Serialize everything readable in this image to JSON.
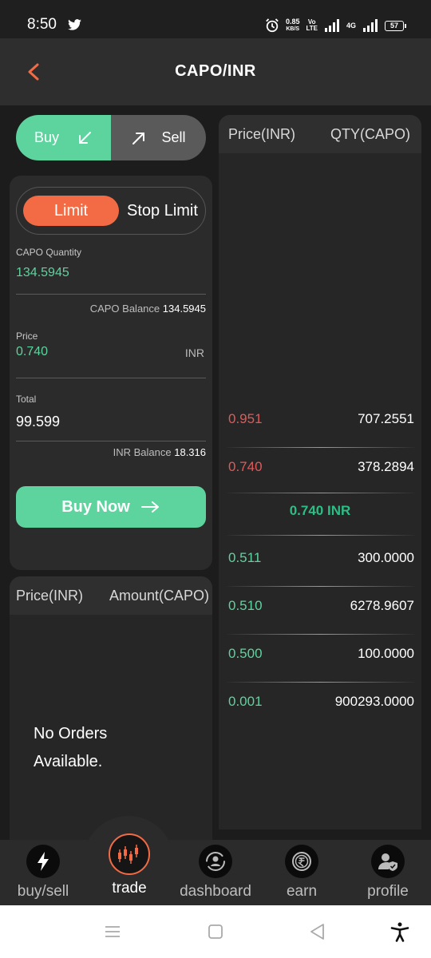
{
  "status_bar": {
    "time": "8:50",
    "net_speed_value": "0.85",
    "net_speed_unit": "KB/S",
    "volte_top": "Vo",
    "volte_bottom": "LTE",
    "network": "4G",
    "battery": "57"
  },
  "header": {
    "title": "CAPO/INR"
  },
  "side_toggle": {
    "buy_label": "Buy",
    "sell_label": "Sell"
  },
  "order_type": {
    "limit_label": "Limit",
    "stop_limit_label": "Stop Limit"
  },
  "form": {
    "quantity_label": "CAPO Quantity",
    "quantity_value": "134.5945",
    "capo_balance_label": "CAPO Balance",
    "capo_balance_value": "134.5945",
    "price_label": "Price",
    "price_value": "0.740",
    "price_unit": "INR",
    "total_label": "Total",
    "total_value": "99.599",
    "inr_balance_label": "INR Balance",
    "inr_balance_value": "18.316",
    "submit_label": "Buy Now"
  },
  "orders": {
    "col_price": "Price(INR)",
    "col_amount": "Amount(CAPO)",
    "empty_line1": "No Orders",
    "empty_line2": "Available."
  },
  "order_book": {
    "col_price": "Price(INR)",
    "col_qty": "QTY(CAPO)",
    "asks": [
      {
        "price": "0.951",
        "qty": "707.2551"
      },
      {
        "price": "0.740",
        "qty": "378.2894"
      }
    ],
    "mid_price": "0.740 INR",
    "bids": [
      {
        "price": "0.511",
        "qty": "300.0000"
      },
      {
        "price": "0.510",
        "qty": "6278.9607"
      },
      {
        "price": "0.500",
        "qty": "100.0000"
      },
      {
        "price": "0.001",
        "qty": "900293.0000"
      }
    ]
  },
  "bottom_nav": {
    "items": [
      {
        "label": "buy/sell",
        "icon": "lightning-icon"
      },
      {
        "label": "trade",
        "icon": "candlestick-icon",
        "active": true
      },
      {
        "label": "dashboard",
        "icon": "refresh-user-icon"
      },
      {
        "label": "earn",
        "icon": "rupee-icon"
      },
      {
        "label": "profile",
        "icon": "user-shield-icon"
      }
    ]
  },
  "colors": {
    "accent_green": "#5dd39e",
    "accent_orange": "#f26b45",
    "ask_red": "#e05a5a"
  }
}
